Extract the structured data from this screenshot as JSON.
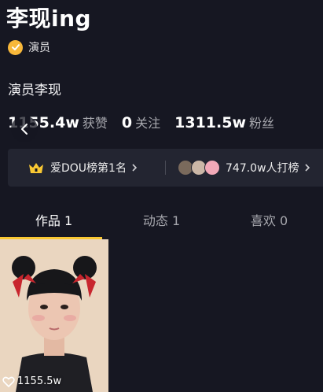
{
  "profile": {
    "name": "李现ing",
    "verify_label": "演员",
    "bio": "演员李现"
  },
  "stats": {
    "likes_count": "1155.4w",
    "likes_label": "获赞",
    "following_count": "0",
    "following_label": "关注",
    "followers_count": "1311.5w",
    "followers_label": "粉丝"
  },
  "rank": {
    "title": "爱DOU榜第1名",
    "supporters": "747.0w人打榜"
  },
  "tabs": {
    "works": "作品 1",
    "dynamics": "动态 1",
    "likes": "喜欢 0"
  },
  "video": {
    "likes": "1155.5w"
  },
  "colors": {
    "background": "#161722",
    "accent_yellow": "#f9c833",
    "verify_badge": "#f8b83a",
    "muted_text": "#a6a7ad"
  },
  "icons": [
    "verified-check-icon",
    "back-arrow-icon",
    "crown-icon",
    "chevron-right-icon",
    "heart-outline-icon"
  ]
}
